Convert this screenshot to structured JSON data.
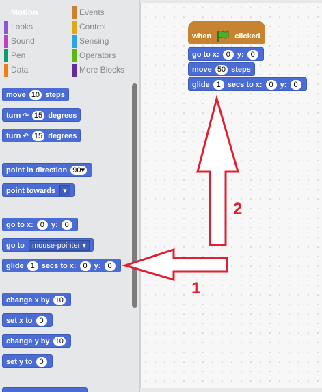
{
  "categories": [
    {
      "label": "Motion",
      "color": "#4a6cd4",
      "active": true
    },
    {
      "label": "Events",
      "color": "#c88330"
    },
    {
      "label": "Looks",
      "color": "#8a55d7"
    },
    {
      "label": "Control",
      "color": "#e1a91a"
    },
    {
      "label": "Sound",
      "color": "#bb42c3"
    },
    {
      "label": "Sensing",
      "color": "#2ca5e2"
    },
    {
      "label": "Pen",
      "color": "#0e9a6c"
    },
    {
      "label": "Operators",
      "color": "#5cb712"
    },
    {
      "label": "Data",
      "color": "#ee7d16"
    },
    {
      "label": "More Blocks",
      "color": "#632d99"
    }
  ],
  "palette": {
    "move": {
      "pre": "move",
      "val": "10",
      "post": "steps"
    },
    "turn_cw": {
      "pre": "turn",
      "val": "15",
      "post": "degrees"
    },
    "turn_ccw": {
      "pre": "turn",
      "val": "15",
      "post": "degrees"
    },
    "point_dir": {
      "pre": "point in direction",
      "val": "90▾"
    },
    "point_towards": {
      "pre": "point towards",
      "val": "▾"
    },
    "goto_xy": {
      "pre": "go to x:",
      "x": "0",
      "mid": "y:",
      "y": "0"
    },
    "goto": {
      "pre": "go to",
      "val": "mouse-pointer ▾"
    },
    "glide": {
      "pre": "glide",
      "secs": "1",
      "mid1": "secs to x:",
      "x": "0",
      "mid2": "y:",
      "y": "0"
    },
    "change_x": {
      "pre": "change x by",
      "val": "10"
    },
    "set_x": {
      "pre": "set x to",
      "val": "0"
    },
    "change_y": {
      "pre": "change y by",
      "val": "10"
    },
    "set_y": {
      "pre": "set y to",
      "val": "0"
    }
  },
  "script": {
    "hat": {
      "pre": "when",
      "post": "clicked"
    },
    "goto_xy": {
      "pre": "go to x:",
      "x": "0",
      "mid": "y:",
      "y": "0"
    },
    "move": {
      "pre": "move",
      "val": "50",
      "post": "steps"
    },
    "glide": {
      "pre": "glide",
      "secs": "1",
      "mid1": "secs to x:",
      "x": "0",
      "mid2": "y:",
      "y": "0"
    }
  },
  "annotations": {
    "one": "1",
    "two": "2"
  },
  "colors": {
    "annotation": "#e02030",
    "motion": "#4a6cd4",
    "events": "#c88330"
  }
}
